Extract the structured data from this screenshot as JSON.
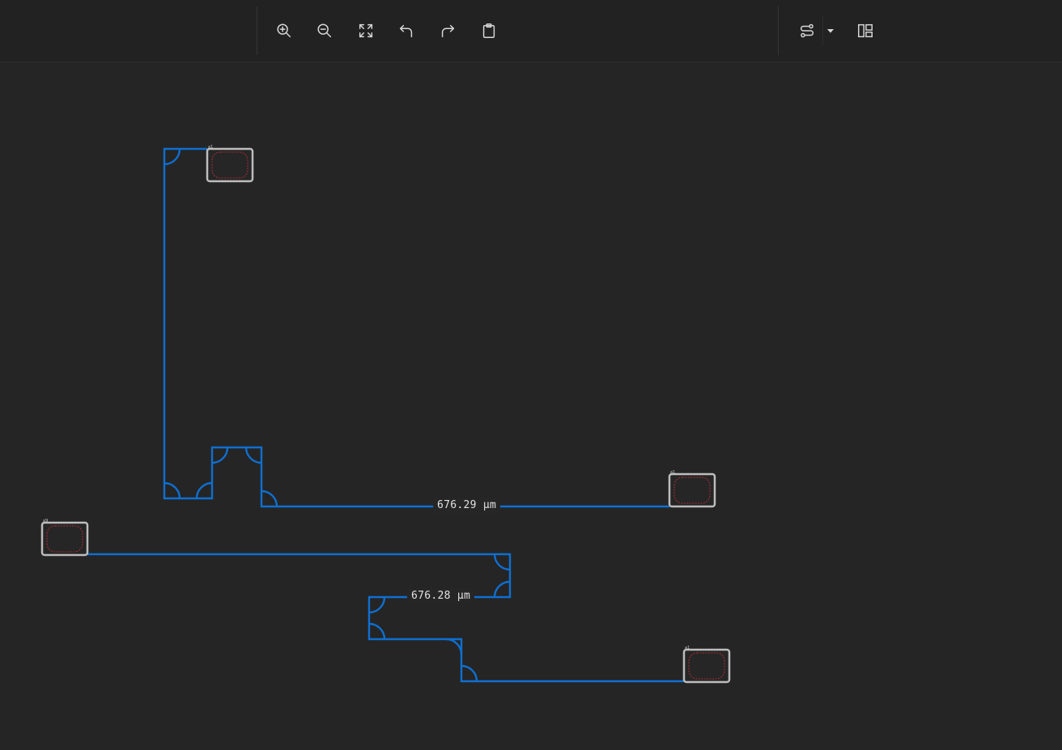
{
  "toolbar": {
    "left_group": [
      {
        "id": "zoom-in",
        "icon": "zoom-in-icon"
      },
      {
        "id": "zoom-out",
        "icon": "zoom-out-icon"
      },
      {
        "id": "fit-view",
        "icon": "fit-screen-icon"
      },
      {
        "id": "undo",
        "icon": "undo-icon"
      },
      {
        "id": "redo",
        "icon": "redo-icon"
      },
      {
        "id": "clipboard",
        "icon": "clipboard-icon"
      }
    ],
    "right_group": [
      {
        "id": "route-mode",
        "icon": "route-icon"
      },
      {
        "id": "route-mode-dropdown",
        "icon": "caret-down-icon"
      },
      {
        "id": "layout-panels",
        "icon": "layout-panels-icon"
      }
    ]
  },
  "canvas": {
    "background": "#252525",
    "route_color": "#0f6fd0",
    "pad_border_color": "#bdbdbd",
    "pad_inner_color": "#d0303a"
  },
  "labels": {
    "length_top": "676.29 µm",
    "length_bottom": "676.28 µm"
  },
  "pads": [
    {
      "id": "pad-a",
      "tag": "a1"
    },
    {
      "id": "pad-b",
      "tag": "a1"
    },
    {
      "id": "pad-c",
      "tag": "x9"
    },
    {
      "id": "pad-d",
      "tag": "a1"
    }
  ]
}
